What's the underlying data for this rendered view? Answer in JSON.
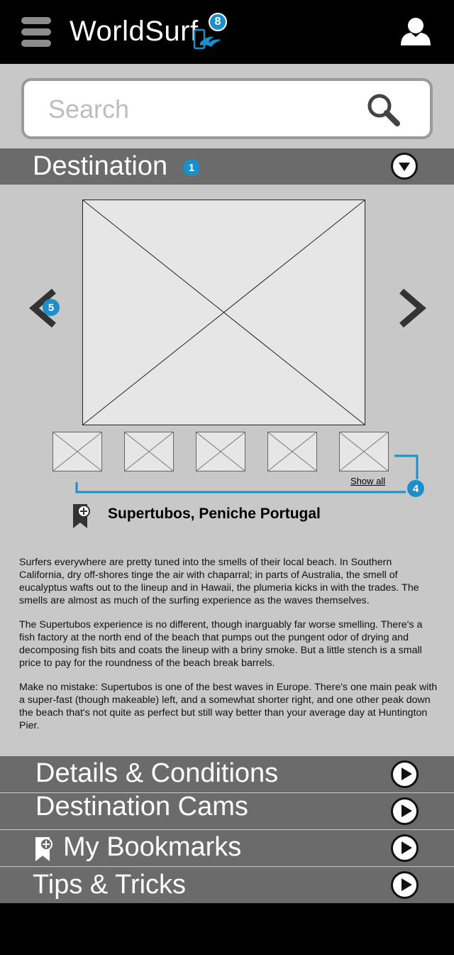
{
  "header": {
    "app_title": "WorldSurf",
    "notification_count": "8",
    "menu_icon": "hamburger-menu-icon",
    "logo_icon": "wave-phone-icon",
    "profile_icon": "user-profile-icon"
  },
  "search": {
    "placeholder": "Search",
    "icon": "search-icon"
  },
  "destination": {
    "title": "Destination",
    "annotation_number": "1",
    "toggle_icon": "chevron-down-circle-icon",
    "carousel_annotation": "5",
    "thumbnails_annotation": "4",
    "show_all_label": "Show all",
    "spot_name": "Supertubos, Peniche Portugal",
    "bookmark_icon": "bookmark-add-icon"
  },
  "article": {
    "paragraphs": [
      "Surfers everywhere are pretty tuned into the smells of their local beach. In Southern California, dry off-shores tinge the air with chaparral; in parts of Australia, the smell of eucalyptus wafts out to the lineup and in Hawaii, the plumeria kicks in with the trades. The smells are almost as much of the surfing experience as the waves themselves.",
      "The Supertubos experience is no different, though inarguably far worse smelling. There's a fish factory at the north end of the beach that pumps out the pungent odor of drying and decomposing fish bits and coats the lineup with a briny smoke. But a little stench is a small price to pay for the roundness of the beach break barrels.",
      "Make no mistake: Supertubos is one of the best waves in Europe. There's one main peak with a super-fast (though makeable) left, and a somewhat shorter right, and one other peak down the beach that's not quite as perfect but still way better than your average day at Huntington Pier."
    ]
  },
  "sections": [
    {
      "label": "Details & Conditions"
    },
    {
      "label": "Destination Cams"
    },
    {
      "label": "My Bookmarks"
    },
    {
      "label": "Tips & Tricks"
    }
  ],
  "colors": {
    "accent": "#1a8fca",
    "header_bg": "#000000",
    "section_bg": "#6b6b6b",
    "content_bg": "#c8c8c8"
  }
}
